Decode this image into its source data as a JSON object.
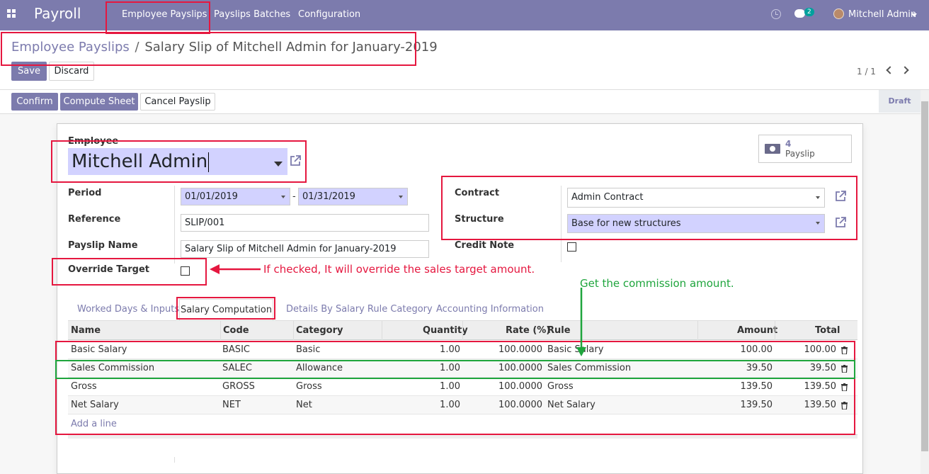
{
  "navbar": {
    "app_name": "Payroll",
    "menu": [
      "Employee Payslips",
      "Payslips Batches",
      "Configuration"
    ],
    "chat_count": "2",
    "user_name": "Mitchell Admin",
    "color": "#7c7bad"
  },
  "breadcrumb": {
    "parent": "Employee Payslips",
    "separator": "/",
    "current": "Salary Slip of Mitchell Admin for January-2019"
  },
  "control": {
    "save_label": "Save",
    "discard_label": "Discard",
    "pager": "1 / 1"
  },
  "status_bar": {
    "confirm_label": "Confirm",
    "compute_label": "Compute Sheet",
    "cancel_label": "Cancel Payslip",
    "state": "Draft"
  },
  "form": {
    "employee_label": "Employee",
    "employee_value": "Mitchell Admin",
    "smart_button": {
      "count": "4",
      "label": "Payslip",
      "icon": "money-icon"
    },
    "period_label": "Period",
    "date_from": "01/01/2019",
    "date_sep": "-",
    "date_to": "01/31/2019",
    "reference_label": "Reference",
    "reference_value": "SLIP/001",
    "payslip_name_label": "Payslip Name",
    "payslip_name_value": "Salary Slip of Mitchell Admin for January-2019",
    "override_target_label": "Override Target",
    "override_target_checked": false,
    "contract_label": "Contract",
    "contract_value": "Admin Contract",
    "structure_label": "Structure",
    "structure_value": "Base for new structures",
    "credit_note_label": "Credit Note",
    "credit_note_checked": false
  },
  "tabs": [
    "Worked Days & Inputs",
    "Salary Computation",
    "Details By Salary Rule Category",
    "Accounting Information"
  ],
  "active_tab": "Salary Computation",
  "table": {
    "columns": [
      "Name",
      "Code",
      "Category",
      "Quantity",
      "Rate (%)",
      "Rule",
      "Amount",
      "Total"
    ],
    "rows": [
      {
        "name": "Basic Salary",
        "code": "BASIC",
        "category": "Basic",
        "quantity": "1.00",
        "rate": "100.0000",
        "rule": "Basic Salary",
        "amount": "100.00",
        "total": "100.00"
      },
      {
        "name": "Sales Commission",
        "code": "SALEC",
        "category": "Allowance",
        "quantity": "1.00",
        "rate": "100.0000",
        "rule": "Sales Commission",
        "amount": "39.50",
        "total": "39.50"
      },
      {
        "name": "Gross",
        "code": "GROSS",
        "category": "Gross",
        "quantity": "1.00",
        "rate": "100.0000",
        "rule": "Gross",
        "amount": "139.50",
        "total": "139.50"
      },
      {
        "name": "Net Salary",
        "code": "NET",
        "category": "Net",
        "quantity": "1.00",
        "rate": "100.0000",
        "rule": "Net Salary",
        "amount": "139.50",
        "total": "139.50"
      }
    ],
    "add_line": "Add a line"
  },
  "annotations": {
    "override_note": "If checked, It will override the sales target amount.",
    "commission_note": "Get the commission amount.",
    "red": "#e5173f",
    "green": "#1fa53d"
  }
}
